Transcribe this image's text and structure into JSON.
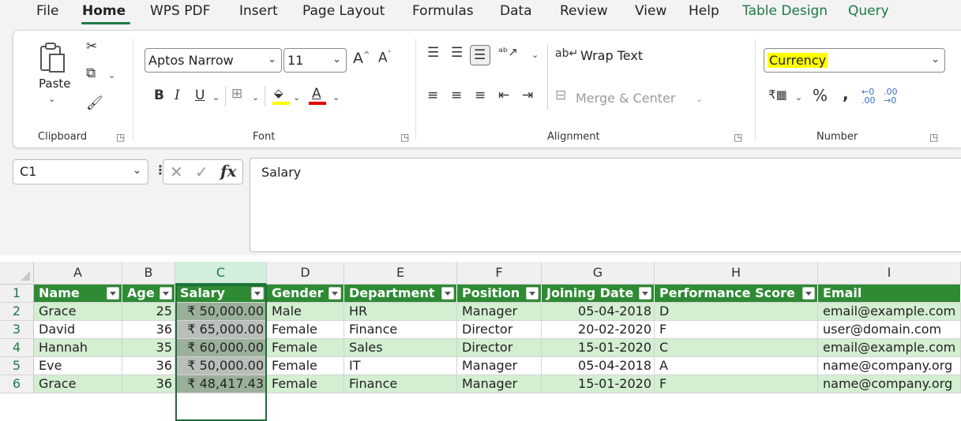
{
  "menu": {
    "tabs": [
      {
        "label": "File"
      },
      {
        "label": "Home"
      },
      {
        "label": "WPS PDF"
      },
      {
        "label": "Insert"
      },
      {
        "label": "Page Layout"
      },
      {
        "label": "Formulas"
      },
      {
        "label": "Data"
      },
      {
        "label": "Review"
      },
      {
        "label": "View"
      },
      {
        "label": "Help"
      },
      {
        "label": "Table Design"
      },
      {
        "label": "Query"
      }
    ]
  },
  "ribbon": {
    "clipboard": {
      "paste_label": "Paste",
      "group_label": "Clipboard"
    },
    "font": {
      "font_name": "Aptos Narrow",
      "font_size": "11",
      "group_label": "Font"
    },
    "alignment": {
      "wrap_text_label": "Wrap Text",
      "merge_center_label": "Merge & Center",
      "group_label": "Alignment"
    },
    "number": {
      "format": "Currency",
      "group_label": "Number"
    }
  },
  "formula_bar": {
    "name_box": "C1",
    "formula": "Salary"
  },
  "sheet": {
    "columns": [
      "A",
      "B",
      "C",
      "D",
      "E",
      "F",
      "G",
      "H",
      "I"
    ],
    "rows": [
      "1",
      "2",
      "3",
      "4",
      "5",
      "6"
    ],
    "headers": [
      "Name",
      "Age",
      "Salary",
      "Gender",
      "Department",
      "Position",
      "Joining Date",
      "Performance Score",
      "Email"
    ],
    "data": [
      [
        "Grace",
        "25",
        "₹ 50,000.00",
        "Male",
        "HR",
        "Manager",
        "05-04-2018",
        "D",
        "email@example.com"
      ],
      [
        "David",
        "36",
        "₹ 65,000.00",
        "Female",
        "Finance",
        "Director",
        "20-02-2020",
        "F",
        "user@domain.com"
      ],
      [
        "Hannah",
        "35",
        "₹ 60,000.00",
        "Female",
        "Sales",
        "Director",
        "15-01-2020",
        "C",
        "email@example.com"
      ],
      [
        "Eve",
        "36",
        "₹ 50,000.00",
        "Female",
        "IT",
        "Manager",
        "05-04-2018",
        "A",
        "name@company.org"
      ],
      [
        "Grace",
        "36",
        "₹ 48,417.43",
        "Female",
        "Finance",
        "Manager",
        "15-01-2020",
        "F",
        "name@company.org"
      ]
    ]
  },
  "colors": {
    "accent": "#1e7a45",
    "table_header": "#2e8b34",
    "band": "#d3eed0",
    "highlight": "#ffff00"
  }
}
